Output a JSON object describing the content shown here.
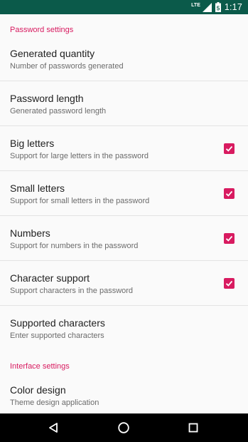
{
  "status_bar": {
    "network": "LTE",
    "battery_level": "5",
    "time": "1:17",
    "background": "#0b5a4a"
  },
  "sections": {
    "password": {
      "title": "Password settings"
    },
    "interface": {
      "title": "Interface settings"
    }
  },
  "prefs": [
    {
      "title": "Generated quantity",
      "summary": "Number of passwords generated"
    },
    {
      "title": "Password length",
      "summary": "Generated password length"
    },
    {
      "title": "Big letters",
      "summary": "Support for large letters in the password",
      "checked": true
    },
    {
      "title": "Small letters",
      "summary": "Support for small letters in the password",
      "checked": true
    },
    {
      "title": "Numbers",
      "summary": "Support for numbers in the password",
      "checked": true
    },
    {
      "title": "Character support",
      "summary": "Support characters in the password",
      "checked": true
    },
    {
      "title": "Supported characters",
      "summary": "Enter supported characters"
    },
    {
      "title": "Color design",
      "summary": "Theme design application"
    }
  ],
  "colors": {
    "accent": "#d81b60",
    "title_text": "#212121",
    "summary_text": "#6b6b6b"
  },
  "nav_bar": {
    "icons": [
      "back-icon",
      "home-icon",
      "recents-icon"
    ]
  }
}
